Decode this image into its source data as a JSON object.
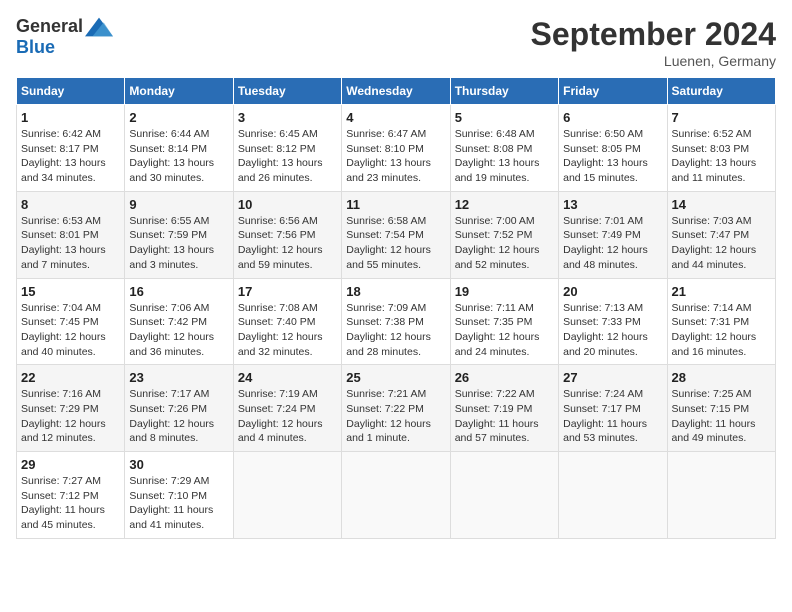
{
  "logo": {
    "general": "General",
    "blue": "Blue"
  },
  "title": "September 2024",
  "location": "Luenen, Germany",
  "weekdays": [
    "Sunday",
    "Monday",
    "Tuesday",
    "Wednesday",
    "Thursday",
    "Friday",
    "Saturday"
  ],
  "weeks": [
    [
      {
        "day": "1",
        "info": "Sunrise: 6:42 AM\nSunset: 8:17 PM\nDaylight: 13 hours\nand 34 minutes."
      },
      {
        "day": "2",
        "info": "Sunrise: 6:44 AM\nSunset: 8:14 PM\nDaylight: 13 hours\nand 30 minutes."
      },
      {
        "day": "3",
        "info": "Sunrise: 6:45 AM\nSunset: 8:12 PM\nDaylight: 13 hours\nand 26 minutes."
      },
      {
        "day": "4",
        "info": "Sunrise: 6:47 AM\nSunset: 8:10 PM\nDaylight: 13 hours\nand 23 minutes."
      },
      {
        "day": "5",
        "info": "Sunrise: 6:48 AM\nSunset: 8:08 PM\nDaylight: 13 hours\nand 19 minutes."
      },
      {
        "day": "6",
        "info": "Sunrise: 6:50 AM\nSunset: 8:05 PM\nDaylight: 13 hours\nand 15 minutes."
      },
      {
        "day": "7",
        "info": "Sunrise: 6:52 AM\nSunset: 8:03 PM\nDaylight: 13 hours\nand 11 minutes."
      }
    ],
    [
      {
        "day": "8",
        "info": "Sunrise: 6:53 AM\nSunset: 8:01 PM\nDaylight: 13 hours\nand 7 minutes."
      },
      {
        "day": "9",
        "info": "Sunrise: 6:55 AM\nSunset: 7:59 PM\nDaylight: 13 hours\nand 3 minutes."
      },
      {
        "day": "10",
        "info": "Sunrise: 6:56 AM\nSunset: 7:56 PM\nDaylight: 12 hours\nand 59 minutes."
      },
      {
        "day": "11",
        "info": "Sunrise: 6:58 AM\nSunset: 7:54 PM\nDaylight: 12 hours\nand 55 minutes."
      },
      {
        "day": "12",
        "info": "Sunrise: 7:00 AM\nSunset: 7:52 PM\nDaylight: 12 hours\nand 52 minutes."
      },
      {
        "day": "13",
        "info": "Sunrise: 7:01 AM\nSunset: 7:49 PM\nDaylight: 12 hours\nand 48 minutes."
      },
      {
        "day": "14",
        "info": "Sunrise: 7:03 AM\nSunset: 7:47 PM\nDaylight: 12 hours\nand 44 minutes."
      }
    ],
    [
      {
        "day": "15",
        "info": "Sunrise: 7:04 AM\nSunset: 7:45 PM\nDaylight: 12 hours\nand 40 minutes."
      },
      {
        "day": "16",
        "info": "Sunrise: 7:06 AM\nSunset: 7:42 PM\nDaylight: 12 hours\nand 36 minutes."
      },
      {
        "day": "17",
        "info": "Sunrise: 7:08 AM\nSunset: 7:40 PM\nDaylight: 12 hours\nand 32 minutes."
      },
      {
        "day": "18",
        "info": "Sunrise: 7:09 AM\nSunset: 7:38 PM\nDaylight: 12 hours\nand 28 minutes."
      },
      {
        "day": "19",
        "info": "Sunrise: 7:11 AM\nSunset: 7:35 PM\nDaylight: 12 hours\nand 24 minutes."
      },
      {
        "day": "20",
        "info": "Sunrise: 7:13 AM\nSunset: 7:33 PM\nDaylight: 12 hours\nand 20 minutes."
      },
      {
        "day": "21",
        "info": "Sunrise: 7:14 AM\nSunset: 7:31 PM\nDaylight: 12 hours\nand 16 minutes."
      }
    ],
    [
      {
        "day": "22",
        "info": "Sunrise: 7:16 AM\nSunset: 7:29 PM\nDaylight: 12 hours\nand 12 minutes."
      },
      {
        "day": "23",
        "info": "Sunrise: 7:17 AM\nSunset: 7:26 PM\nDaylight: 12 hours\nand 8 minutes."
      },
      {
        "day": "24",
        "info": "Sunrise: 7:19 AM\nSunset: 7:24 PM\nDaylight: 12 hours\nand 4 minutes."
      },
      {
        "day": "25",
        "info": "Sunrise: 7:21 AM\nSunset: 7:22 PM\nDaylight: 12 hours\nand 1 minute."
      },
      {
        "day": "26",
        "info": "Sunrise: 7:22 AM\nSunset: 7:19 PM\nDaylight: 11 hours\nand 57 minutes."
      },
      {
        "day": "27",
        "info": "Sunrise: 7:24 AM\nSunset: 7:17 PM\nDaylight: 11 hours\nand 53 minutes."
      },
      {
        "day": "28",
        "info": "Sunrise: 7:25 AM\nSunset: 7:15 PM\nDaylight: 11 hours\nand 49 minutes."
      }
    ],
    [
      {
        "day": "29",
        "info": "Sunrise: 7:27 AM\nSunset: 7:12 PM\nDaylight: 11 hours\nand 45 minutes."
      },
      {
        "day": "30",
        "info": "Sunrise: 7:29 AM\nSunset: 7:10 PM\nDaylight: 11 hours\nand 41 minutes."
      },
      {
        "day": "",
        "info": ""
      },
      {
        "day": "",
        "info": ""
      },
      {
        "day": "",
        "info": ""
      },
      {
        "day": "",
        "info": ""
      },
      {
        "day": "",
        "info": ""
      }
    ]
  ]
}
